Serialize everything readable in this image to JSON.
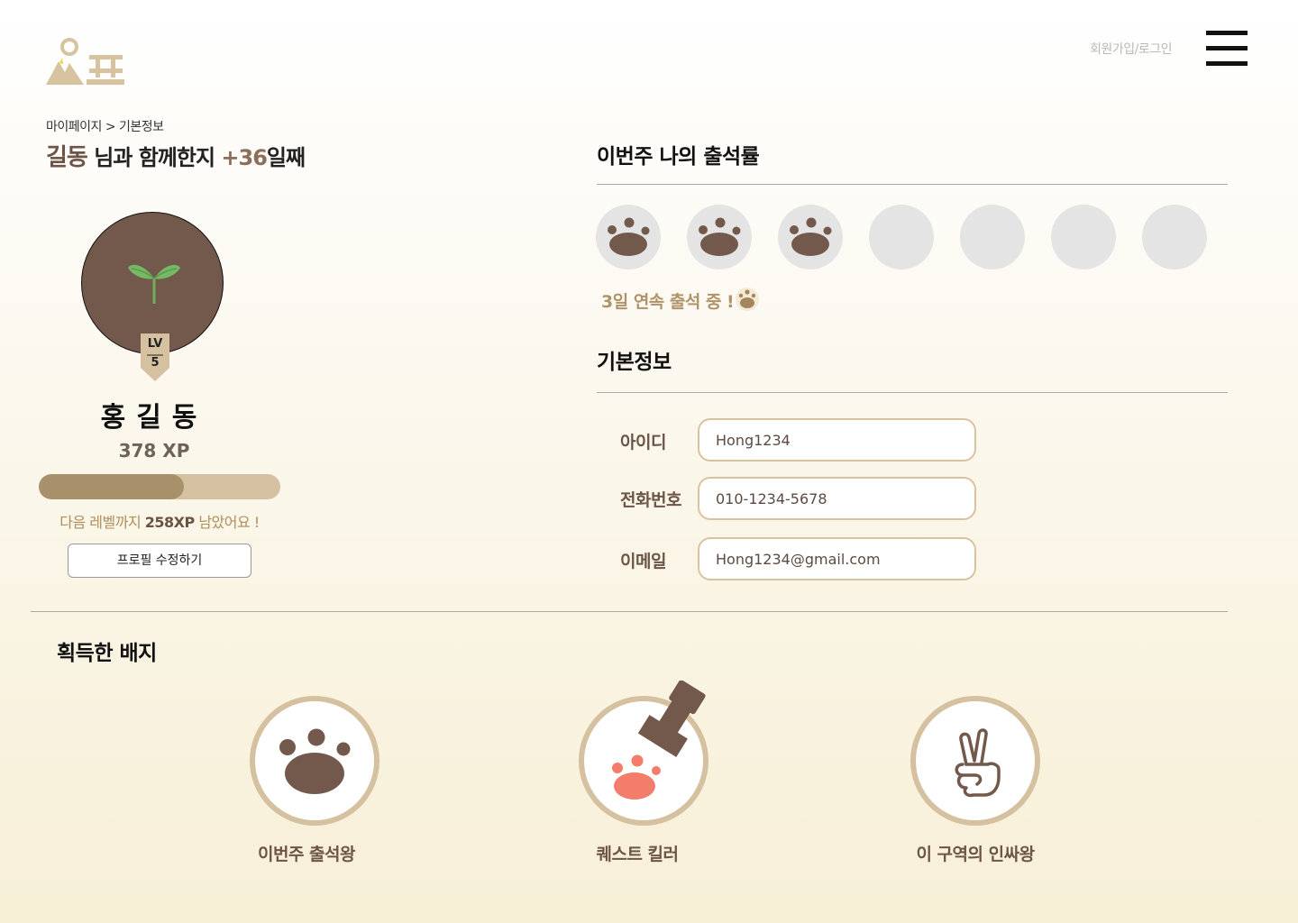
{
  "header": {
    "logo_icon": "mountain-logo-icon",
    "login_link": "회원가입/로그인",
    "menu_icon": "hamburger-menu-icon"
  },
  "profile": {
    "breadcrumb": "마이페이지 > 기본정보",
    "greeting_name": "길동",
    "greeting_mid": " 님과 함께한지 ",
    "greeting_days": "+36",
    "greeting_end": "일째",
    "avatar_icon": "sprout-icon",
    "level_label": "LV",
    "level_value": "5",
    "name": "홍길동",
    "xp": "378 XP",
    "xp_progress": 0.6,
    "next_level_prefix": "다음 레벨까지 ",
    "next_level_xp": "258XP",
    "next_level_suffix": " 남았어요 !",
    "edit_button": "프로필 수정하기"
  },
  "attendance": {
    "title": "이번주 나의 출석률",
    "days_total": 7,
    "days_attended": 3,
    "attended_icon": "paw-icon",
    "streak_text": "3일 연속 출석 중 !"
  },
  "basic_info": {
    "title": "기본정보",
    "fields": [
      {
        "label": "아이디",
        "value": "Hong1234"
      },
      {
        "label": "전화번호",
        "value": "010-1234-5678"
      },
      {
        "label": "이메일",
        "value": "Hong1234@gmail.com"
      }
    ]
  },
  "badges": {
    "title": "획득한 배지",
    "items": [
      {
        "label": "이번주 출석왕",
        "icon": "paw-icon"
      },
      {
        "label": "퀘스트 킬러",
        "icon": "paw-stamp-icon"
      },
      {
        "label": "이 구역의 인싸왕",
        "icon": "peace-hand-icon"
      }
    ]
  },
  "colors": {
    "brown": "#73594b",
    "tan": "#d5c09f",
    "xp_fill": "#a8916a",
    "coral": "#f47c6a"
  }
}
